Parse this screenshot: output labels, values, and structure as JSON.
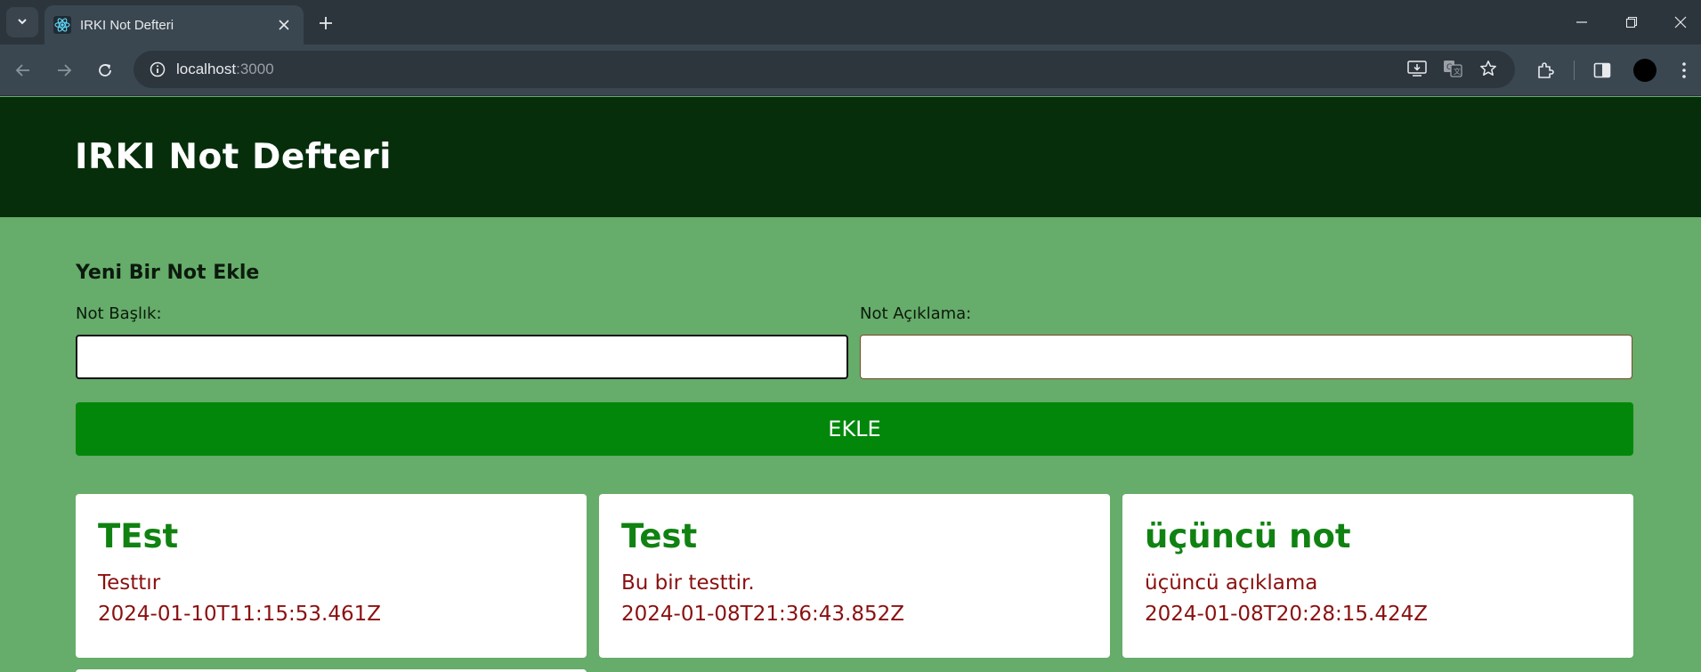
{
  "browser": {
    "tab_title": "IRKI Not Defteri",
    "url_host": "localhost",
    "url_port": ":3000"
  },
  "app": {
    "title": "IRKI Not Defteri"
  },
  "form": {
    "heading": "Yeni Bir Not Ekle",
    "title_label": "Not Başlık:",
    "title_value": "",
    "desc_label": "Not Açıklama:",
    "desc_value": "",
    "submit_label": "EKLE"
  },
  "notes": [
    {
      "title": "TEst",
      "description": "Testtır",
      "date": "2024-01-10T11:15:53.461Z"
    },
    {
      "title": "Test",
      "description": "Bu bir testtir.",
      "date": "2024-01-08T21:36:43.852Z"
    },
    {
      "title": "üçüncü not",
      "description": "üçüncü açıklama",
      "date": "2024-01-08T20:28:15.424Z"
    }
  ],
  "colors": {
    "header_bg": "#062e0b",
    "page_bg": "#66ac6a",
    "button_bg": "#02870a",
    "note_title": "#108212",
    "note_text": "#8a1010"
  },
  "icons": [
    "tab-search-icon",
    "react-favicon-icon",
    "close-icon",
    "plus-icon",
    "minimize-icon",
    "restore-icon",
    "window-close-icon",
    "back-icon",
    "forward-icon",
    "reload-icon",
    "site-info-icon",
    "install-app-icon",
    "translate-icon",
    "bookmark-star-icon",
    "extensions-icon",
    "side-panel-icon",
    "profile-avatar"
  ]
}
